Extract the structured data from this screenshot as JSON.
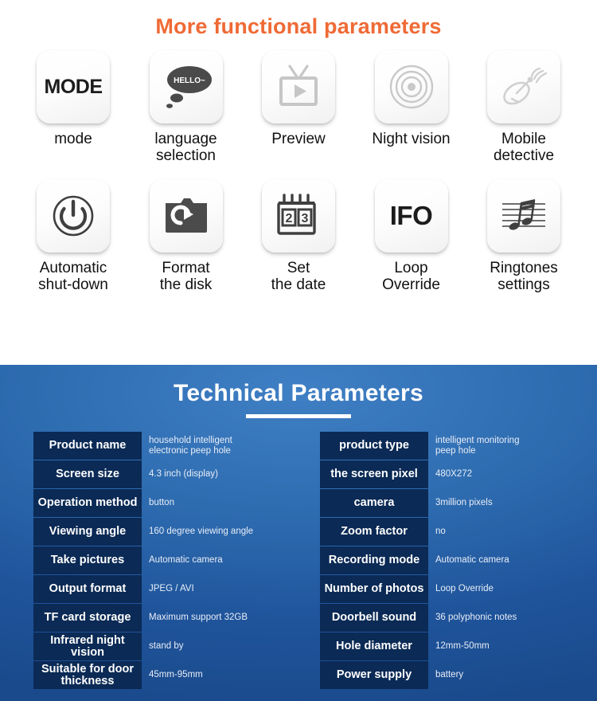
{
  "features": {
    "title": "More functional parameters",
    "items": [
      {
        "icon": "mode-text-icon",
        "tile_text": "MODE",
        "label": "mode"
      },
      {
        "icon": "speech-bubble-icon",
        "tile_text": "HELLO~",
        "label": "language\nselection"
      },
      {
        "icon": "tv-play-icon",
        "tile_text": "",
        "label": "Preview"
      },
      {
        "icon": "concentric-circles-icon",
        "tile_text": "",
        "label": "Night vision"
      },
      {
        "icon": "satellite-dish-icon",
        "tile_text": "",
        "label": "Mobile\ndetective"
      },
      {
        "icon": "power-icon",
        "tile_text": "",
        "label": "Automatic\nshut-down"
      },
      {
        "icon": "folder-refresh-icon",
        "tile_text": "",
        "label": "Format\nthe disk"
      },
      {
        "icon": "calendar-icon",
        "tile_text": "23",
        "label": "Set\nthe date"
      },
      {
        "icon": "ifo-text-icon",
        "tile_text": "IFO",
        "label": "Loop\nOverride"
      },
      {
        "icon": "music-staff-icon",
        "tile_text": "",
        "label": "Ringtones\nsettings"
      }
    ]
  },
  "technical": {
    "title": "Technical Parameters",
    "left_rows": [
      {
        "label": "Product name",
        "value": "household intelligent\nelectronic peep hole"
      },
      {
        "label": "Screen size",
        "value": "4.3 inch (display)"
      },
      {
        "label": "Operation method",
        "value": "button"
      },
      {
        "label": "Viewing angle",
        "value": "160 degree viewing angle"
      },
      {
        "label": "Take pictures",
        "value": "Automatic camera"
      },
      {
        "label": "Output format",
        "value": "JPEG / AVI"
      },
      {
        "label": "TF card storage",
        "value": "Maximum support 32GB"
      },
      {
        "label": "Infrared night\nvision",
        "value": "stand by"
      },
      {
        "label": "Suitable for door\nthickness",
        "value": "45mm-95mm"
      }
    ],
    "right_rows": [
      {
        "label": "product type",
        "value": "intelligent monitoring\npeep hole"
      },
      {
        "label": "the screen pixel",
        "value": "480X272"
      },
      {
        "label": "camera",
        "value": "3million pixels"
      },
      {
        "label": "Zoom factor",
        "value": "no"
      },
      {
        "label": "Recording mode",
        "value": "Automatic camera"
      },
      {
        "label": "Number of photos",
        "value": "Loop Override"
      },
      {
        "label": "Doorbell sound",
        "value": "36 polyphonic notes"
      },
      {
        "label": "Hole diameter",
        "value": "12mm-50mm"
      },
      {
        "label": "Power supply",
        "value": "battery"
      }
    ]
  },
  "colors": {
    "features_title": "#ef6a35",
    "tech_bg_light": "#3f7fc4",
    "tech_bg_dark": "#1a4a8c",
    "label_cell": "#0b2a55",
    "icon_gray": "#4a4a4a",
    "icon_light_gray": "#c9c9c9"
  }
}
